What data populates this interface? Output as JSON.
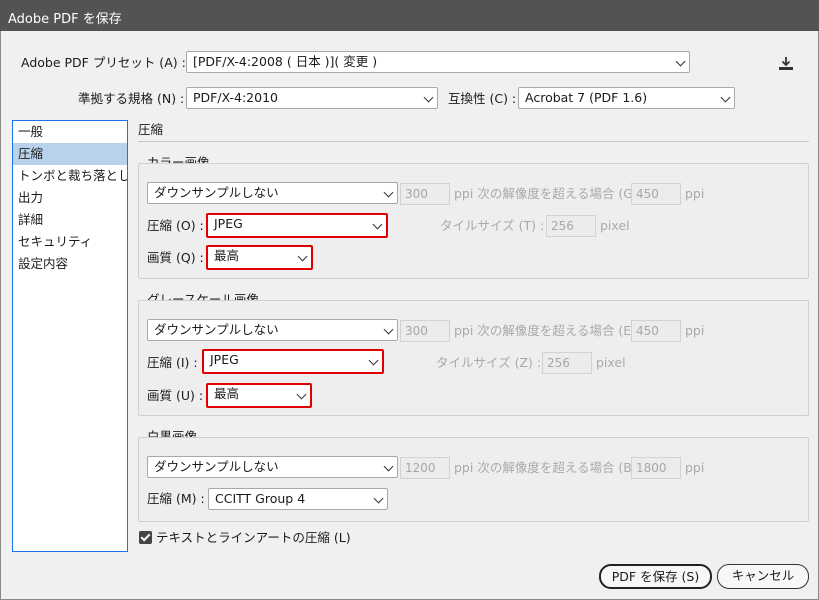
{
  "window": {
    "title": "Adobe PDF を保存"
  },
  "preset": {
    "label": "Adobe PDF プリセット (A) :",
    "value": "[PDF/X-4:2008 ( 日本 )]( 変更 )"
  },
  "standard": {
    "label": "準拠する規格 (N) :",
    "value": "PDF/X-4:2010"
  },
  "compat": {
    "label": "互換性 (C) :",
    "value": "Acrobat 7 (PDF 1.6)"
  },
  "sidebar": {
    "items": [
      {
        "label": "一般"
      },
      {
        "label": "圧縮"
      },
      {
        "label": "トンボと裁ち落とし"
      },
      {
        "label": "出力"
      },
      {
        "label": "詳細"
      },
      {
        "label": "セキュリティ"
      },
      {
        "label": "設定内容"
      }
    ],
    "active_index": 1
  },
  "section": {
    "title": "圧縮"
  },
  "color": {
    "title": "カラー画像",
    "downsample": "ダウンサンプルしない",
    "ppi_value": "300",
    "threshold_label": "ppi 次の解像度を超える場合 (G)",
    "threshold_value": "450",
    "ppi_unit": "ppi",
    "compression_label": "圧縮 (O) :",
    "compression_value": "JPEG",
    "tile_label": "タイルサイズ (T) :",
    "tile_value": "256",
    "tile_unit": "pixel",
    "quality_label": "画質 (Q) :",
    "quality_value": "最高"
  },
  "gray": {
    "title": "グレースケール画像",
    "downsample": "ダウンサンプルしない",
    "ppi_value": "300",
    "threshold_label": "ppi 次の解像度を超える場合 (E)",
    "threshold_value": "450",
    "ppi_unit": "ppi",
    "compression_label": "圧縮 (I) :",
    "compression_value": "JPEG",
    "tile_label": "タイルサイズ (Z) :",
    "tile_value": "256",
    "tile_unit": "pixel",
    "quality_label": "画質 (U) :",
    "quality_value": "最高"
  },
  "mono": {
    "title": "白黒画像",
    "downsample": "ダウンサンプルしない",
    "ppi_value": "1200",
    "threshold_label": "ppi 次の解像度を超える場合 (B)",
    "threshold_value": "1800",
    "ppi_unit": "ppi",
    "compression_label": "圧縮 (M) :",
    "compression_value": "CCITT Group 4"
  },
  "text_compress": {
    "label": "テキストとラインアートの圧縮 (L)",
    "checked": true
  },
  "buttons": {
    "save": "PDF を保存 (S)",
    "cancel": "キャンセル"
  },
  "colors": {
    "highlight": "#e00000",
    "sidebar_active": "#b9d1ea",
    "titlebar": "#535353"
  },
  "icons": {
    "preset_save": "download-icon",
    "checkbox": "checkmark-icon"
  }
}
